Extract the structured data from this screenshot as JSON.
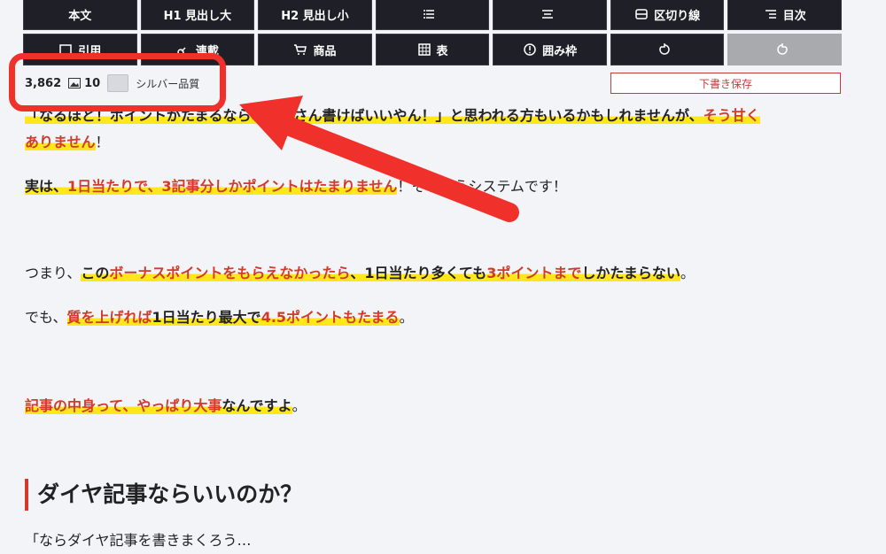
{
  "toolbar": {
    "row1": [
      {
        "name": "body-text-button",
        "label": "本文",
        "icon": ""
      },
      {
        "name": "h1-button",
        "label": "H1 見出し大",
        "icon": ""
      },
      {
        "name": "h2-button",
        "label": "H2 見出し小",
        "icon": ""
      },
      {
        "name": "list-button",
        "label": "",
        "icon": "list-icon"
      },
      {
        "name": "center-button",
        "label": "",
        "icon": "align-center-icon"
      },
      {
        "name": "divider-button",
        "label": "区切り線",
        "icon": "divider-icon"
      },
      {
        "name": "toc-button",
        "label": "目次",
        "icon": "toc-icon"
      }
    ],
    "row2": [
      {
        "name": "link-button",
        "label": "引用",
        "icon": "quote-icon"
      },
      {
        "name": "series-button",
        "label": "連載",
        "icon": "link-icon"
      },
      {
        "name": "product-button",
        "label": "商品",
        "icon": "cart-icon"
      },
      {
        "name": "table-button",
        "label": "表",
        "icon": "table-icon"
      },
      {
        "name": "box-button",
        "label": "囲み枠",
        "icon": "alert-icon"
      },
      {
        "name": "undo-button",
        "label": "",
        "icon": "undo-icon"
      },
      {
        "name": "redo-button",
        "label": "",
        "icon": "redo-icon"
      }
    ]
  },
  "status": {
    "char_count": "3,862",
    "image_count": "10",
    "quality": "シルバー品質"
  },
  "save_label": "下書き保存",
  "article": {
    "l1a": "「なるほど！ポイントがたまるなら、たくさん書けばいいやん！」と思われる方もいるかもしれませんが、",
    "l1b": "そう甘く",
    "l2a": "ありません",
    "l2b": "！",
    "l3a": "実は、",
    "l3b": "1日当たりで、3記事分しかポイントはたまりません",
    "l3c": "！そういうシステムです！",
    "l4a": "つまり、",
    "l4b": "この",
    "l4c": "ボーナスポイントをもらえなかったら",
    "l4d": "、1日当たり多くても",
    "l4e": "3ポイントまで",
    "l4f": "しかたまらない",
    "l4g": "。",
    "l5a": "でも、",
    "l5b": "質を上げれば",
    "l5c": "1日当たり最大で",
    "l5d": "4.5ポイントもたまる",
    "l5e": "。",
    "l6a": "記事の中身って、やっぱり大事",
    "l6b": "なんですよ",
    "l6c": "。",
    "heading": "ダイヤ記事ならいいのか？",
    "l7": "「ならダイヤ記事を書きまくろう…"
  }
}
